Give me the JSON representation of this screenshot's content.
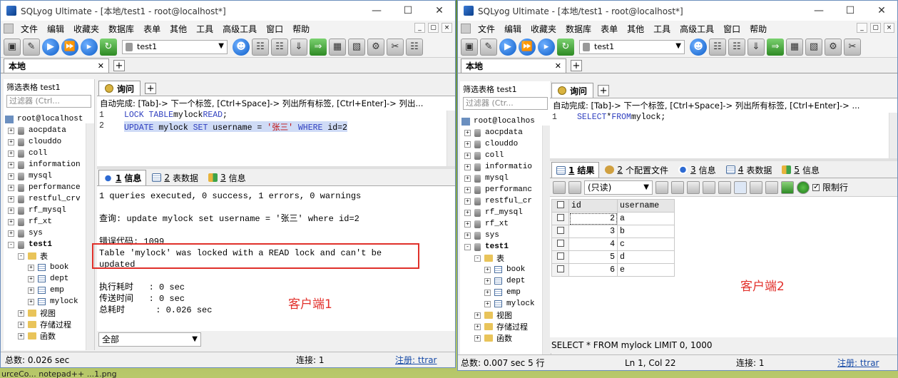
{
  "window1": {
    "title": "SQLyog Ultimate - [本地/test1 - root@localhost*]",
    "menu": [
      "文件",
      "编辑",
      "收藏夹",
      "数据库",
      "表单",
      "其他",
      "工具",
      "高级工具",
      "窗口",
      "帮助"
    ],
    "db_selector": "test1",
    "conn_tab": "本地",
    "filter_label": "筛选表格 test1",
    "filter_placeholder": "过滤器 (Ctrl...",
    "tree": [
      {
        "label": "root@localhost",
        "kind": "server"
      },
      {
        "label": "aocpdata",
        "kind": "db"
      },
      {
        "label": "clouddo",
        "kind": "db"
      },
      {
        "label": "coll",
        "kind": "db"
      },
      {
        "label": "information",
        "kind": "db"
      },
      {
        "label": "mysql",
        "kind": "db"
      },
      {
        "label": "performance",
        "kind": "db"
      },
      {
        "label": "restful_crv",
        "kind": "db"
      },
      {
        "label": "rf_mysql",
        "kind": "db"
      },
      {
        "label": "rf_xt",
        "kind": "db"
      },
      {
        "label": "sys",
        "kind": "db"
      },
      {
        "label": "test1",
        "kind": "db-open"
      },
      {
        "label": "表",
        "kind": "folder"
      },
      {
        "label": "book",
        "kind": "table"
      },
      {
        "label": "dept",
        "kind": "table"
      },
      {
        "label": "emp",
        "kind": "table"
      },
      {
        "label": "mylock",
        "kind": "table"
      },
      {
        "label": "视图",
        "kind": "folder2"
      },
      {
        "label": "存储过程",
        "kind": "folder2"
      },
      {
        "label": "函数",
        "kind": "folder2"
      }
    ],
    "query_tab": "询问",
    "autocomplete": "自动完成: [Tab]-> 下一个标签, [Ctrl+Space]-> 列出所有标签, [Ctrl+Enter]-> 列出...",
    "sql": {
      "l1": {
        "num": "1",
        "kw1": "LOCK TABLE",
        "t1": " mylock ",
        "kw2": "READ",
        "t2": ";"
      },
      "l2": {
        "num": "2",
        "kw1": "UPDATE",
        "t1": " mylock ",
        "kw2": "SET",
        "t2": " username = ",
        "s": "'张三'",
        "t3": " ",
        "kw3": "WHERE",
        "t4": " id=2"
      }
    },
    "result_tabs": [
      {
        "num": "1",
        "label": "信息"
      },
      {
        "num": "2",
        "label": "表数据"
      },
      {
        "num": "3",
        "label": "信息"
      }
    ],
    "messages": {
      "summary": "1 queries executed, 0 success, 1 errors, 0 warnings",
      "query": "查询: update mylock set username = '张三' where id=2",
      "error_code": "错误代码: 1099",
      "error_line1": "Table 'mylock' was locked with a READ lock and can't be",
      "error_line2": "updated",
      "exec_time": "执行耗时   : 0 sec",
      "transfer_time": "传送时间   : 0 sec",
      "total_time": "总耗时      : 0.026 sec"
    },
    "annotation": "客户端1",
    "bottom_select": "全部",
    "status": {
      "total": "总数: 0.026 sec",
      "conn": "连接: 1",
      "reg": "注册: ttrar"
    }
  },
  "window2": {
    "title": "SQLyog Ultimate - [本地/test1 - root@localhost*]",
    "menu": [
      "文件",
      "编辑",
      "收藏夹",
      "数据库",
      "表单",
      "其他",
      "工具",
      "高级工具",
      "窗口",
      "帮助"
    ],
    "db_selector": "test1",
    "conn_tab": "本地",
    "filter_label": "筛选表格 test1",
    "filter_placeholder": "过滤器 (Ctr...",
    "tree": [
      {
        "label": "root@localhos",
        "kind": "server"
      },
      {
        "label": "aocpdata",
        "kind": "db"
      },
      {
        "label": "clouddo",
        "kind": "db"
      },
      {
        "label": "coll",
        "kind": "db"
      },
      {
        "label": "informatio",
        "kind": "db"
      },
      {
        "label": "mysql",
        "kind": "db"
      },
      {
        "label": "performanc",
        "kind": "db"
      },
      {
        "label": "restful_cr",
        "kind": "db"
      },
      {
        "label": "rf_mysql",
        "kind": "db"
      },
      {
        "label": "rf_xt",
        "kind": "db"
      },
      {
        "label": "sys",
        "kind": "db"
      },
      {
        "label": "test1",
        "kind": "db-open"
      },
      {
        "label": "表",
        "kind": "folder"
      },
      {
        "label": "book",
        "kind": "table"
      },
      {
        "label": "dept",
        "kind": "table"
      },
      {
        "label": "emp",
        "kind": "table"
      },
      {
        "label": "mylock",
        "kind": "table"
      },
      {
        "label": "视图",
        "kind": "folder2"
      },
      {
        "label": "存储过程",
        "kind": "folder2"
      },
      {
        "label": "函数",
        "kind": "folder2"
      }
    ],
    "query_tab": "询问",
    "autocomplete": "自动完成: [Tab]-> 下一个标签, [Ctrl+Space]-> 列出所有标签, [Ctrl+Enter]-> ...",
    "sql": {
      "num": "1",
      "kw1": "SELECT",
      "t1": " * ",
      "kw2": "FROM",
      "t2": " mylock;"
    },
    "result_tabs": [
      {
        "num": "1",
        "label": "结果"
      },
      {
        "num": "2",
        "label": "个配置文件"
      },
      {
        "num": "3",
        "label": "信息"
      },
      {
        "num": "4",
        "label": "表数据"
      },
      {
        "num": "5",
        "label": "信息"
      }
    ],
    "readonly_select": "(只读)",
    "limit_label": "限制行",
    "grid": {
      "columns": [
        "id",
        "username"
      ],
      "rows": [
        [
          "2",
          "a"
        ],
        [
          "3",
          "b"
        ],
        [
          "4",
          "c"
        ],
        [
          "5",
          "d"
        ],
        [
          "6",
          "e"
        ]
      ]
    },
    "annotation": "客户端2",
    "sql_status": "SELECT * FROM mylock LIMIT 0, 1000",
    "status": {
      "total": "总数: 0.007 sec 5 行",
      "pos": "Ln 1, Col 22",
      "conn": "连接: 1",
      "reg": "注册: ttrar"
    }
  },
  "desktop_taskbar": "urceCo...   notepad++   ...1.png"
}
